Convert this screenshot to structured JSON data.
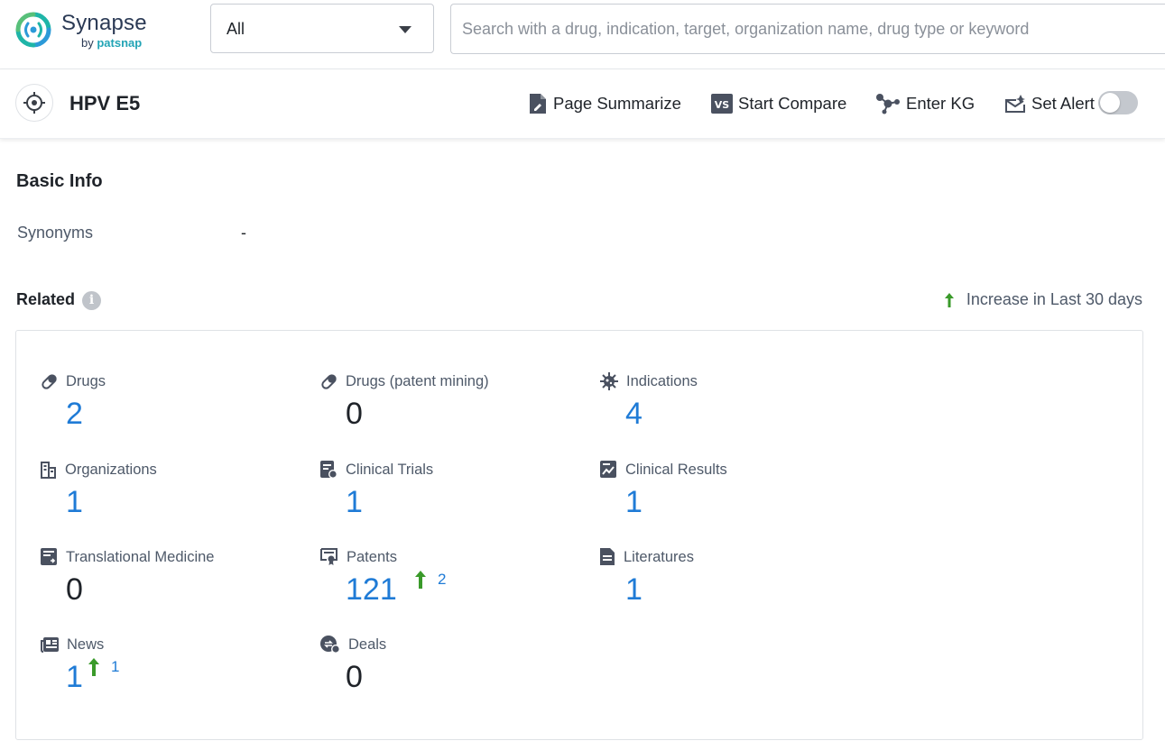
{
  "app": {
    "brand_name": "Synapse",
    "brand_by": "by",
    "brand_company": "patsnap",
    "scope_value": "All",
    "search_placeholder": "Search with a drug, indication, target, organization name, drug type or keyword"
  },
  "entity": {
    "title": "HPV E5",
    "actions": {
      "summarize": "Page Summarize",
      "compare": "Start Compare",
      "kg": "Enter KG",
      "alert": "Set Alert"
    },
    "alert_enabled": false
  },
  "basic_info": {
    "title": "Basic Info",
    "synonyms_label": "Synonyms",
    "synonyms_value": "-"
  },
  "related": {
    "title": "Related",
    "legend": "Increase in Last 30 days",
    "items": [
      {
        "label": "Drugs",
        "count": "2",
        "icon": "pill-icon"
      },
      {
        "label": "Drugs (patent mining)",
        "count": "0",
        "icon": "pill-icon"
      },
      {
        "label": "Indications",
        "count": "4",
        "icon": "virus-icon"
      },
      {
        "label": "Organizations",
        "count": "1",
        "icon": "building-icon"
      },
      {
        "label": "Clinical Trials",
        "count": "1",
        "icon": "clipboard-icon"
      },
      {
        "label": "Clinical Results",
        "count": "1",
        "icon": "chart-doc-icon"
      },
      {
        "label": "Translational Medicine",
        "count": "0",
        "icon": "report-icon"
      },
      {
        "label": "Patents",
        "count": "121",
        "increase": "2",
        "icon": "certificate-icon"
      },
      {
        "label": "Literatures",
        "count": "1",
        "icon": "document-icon"
      },
      {
        "label": "News",
        "count": "1",
        "increase": "1",
        "icon": "newspaper-icon"
      },
      {
        "label": "Deals",
        "count": "0",
        "icon": "deal-icon"
      }
    ]
  },
  "colors": {
    "link_blue": "#1f7bd6",
    "increase_green": "#3a9a2a",
    "icon_gray": "#4a5160",
    "brand_teal": "#22a4b5"
  }
}
